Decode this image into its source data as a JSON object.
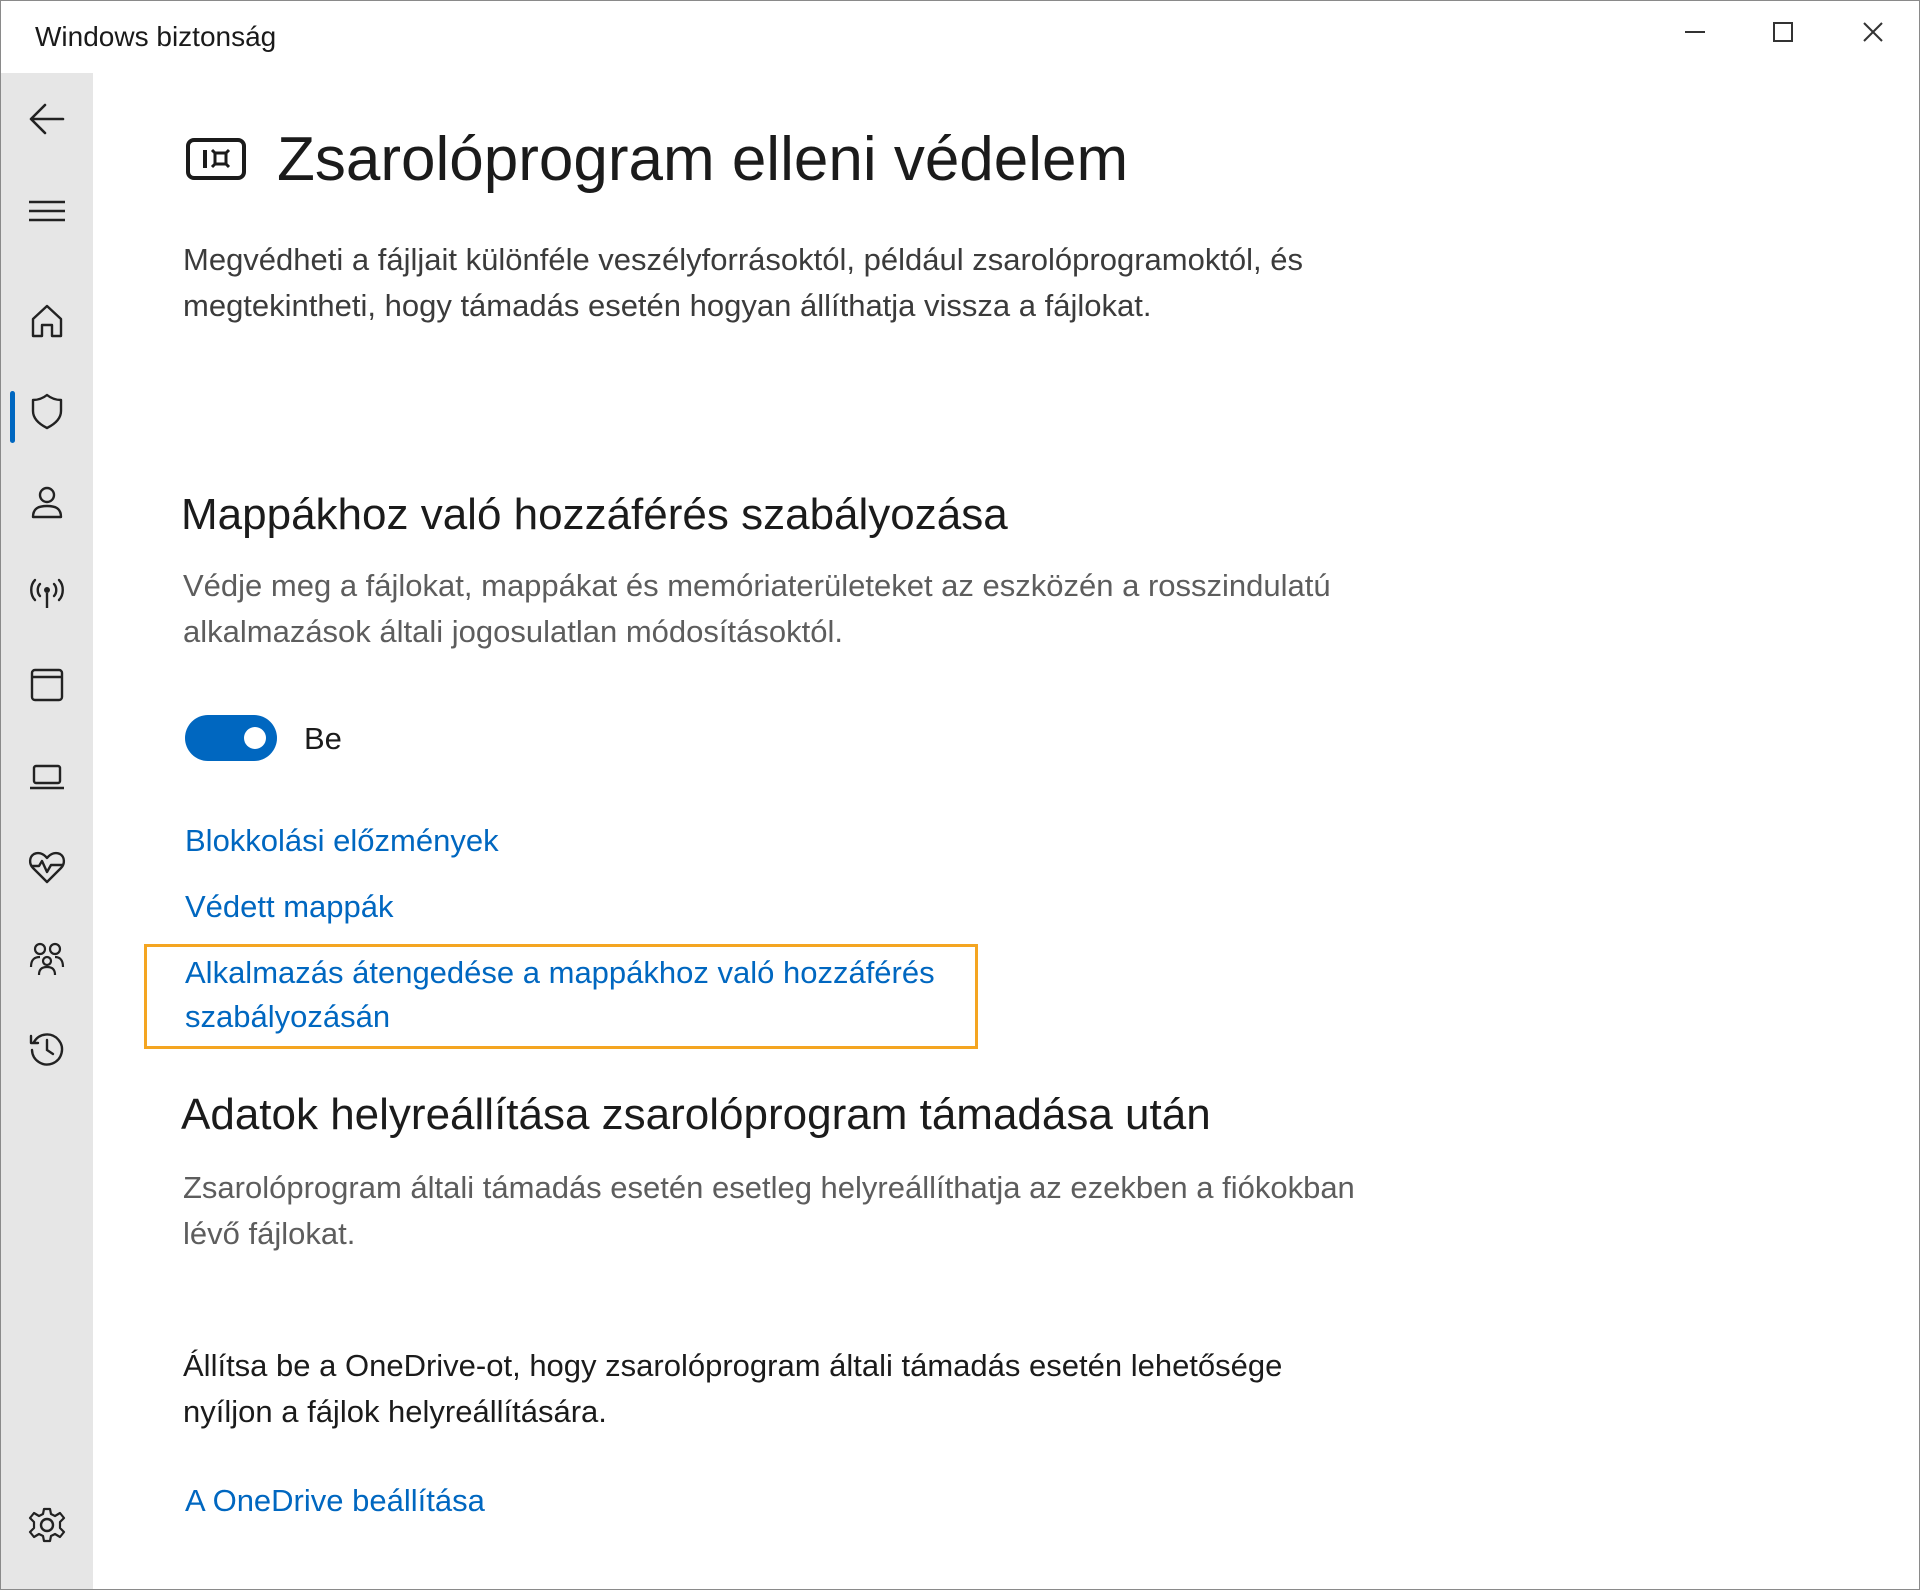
{
  "window": {
    "title": "Windows biztonság",
    "controls": {
      "minimize": "minimize-icon",
      "maximize": "maximize-icon",
      "close": "close-icon"
    }
  },
  "sidebar": {
    "items": [
      {
        "id": "back",
        "icon": "back-arrow-icon",
        "active": false
      },
      {
        "id": "menu",
        "icon": "hamburger-menu-icon",
        "active": false
      },
      {
        "id": "home",
        "icon": "home-icon",
        "active": false
      },
      {
        "id": "virus",
        "icon": "shield-icon",
        "active": true
      },
      {
        "id": "account",
        "icon": "person-icon",
        "active": false
      },
      {
        "id": "firewall",
        "icon": "antenna-icon",
        "active": false
      },
      {
        "id": "app-browser",
        "icon": "app-window-icon",
        "active": false
      },
      {
        "id": "device-security",
        "icon": "laptop-icon",
        "active": false
      },
      {
        "id": "device-health",
        "icon": "heart-pulse-icon",
        "active": false
      },
      {
        "id": "family",
        "icon": "family-icon",
        "active": false
      },
      {
        "id": "history",
        "icon": "history-icon",
        "active": false
      },
      {
        "id": "settings",
        "icon": "gear-icon",
        "active": false
      }
    ],
    "accent_color": "#0067c0"
  },
  "page": {
    "title_icon": "ransomware-icon",
    "title": "Zsarolóprogram elleni védelem",
    "description": "Megvédheti a fájljait különféle veszélyforrásoktól, például zsarolóprogramoktól, és megtekintheti, hogy támadás esetén hogyan állíthatja vissza a fájlokat."
  },
  "folder_access": {
    "title": "Mappákhoz való hozzáférés szabályozása",
    "description": "Védje meg a fájlokat, mappákat és memóriaterületeket az eszközén a rosszindulatú alkalmazások általi jogosulatlan módosításoktól.",
    "toggle_state": "on",
    "toggle_label": "Be",
    "links": [
      "Blokkolási előzmények",
      "Védett mappák",
      "Alkalmazás átengedése a mappákhoz való hozzáférés szabályozásán"
    ],
    "highlight_color": "#f4a521"
  },
  "recovery": {
    "title": "Adatok helyreállítása zsarolóprogram támadása után",
    "description": "Zsarolóprogram általi támadás esetén esetleg helyreállíthatja az ezekben a fiókokban lévő fájlokat.",
    "onedrive_text": "Állítsa be a OneDrive-ot, hogy zsarolóprogram általi támadás esetén lehetősége nyíljon a fájlok helyreállítására.",
    "onedrive_link": "A OneDrive beállítása"
  }
}
